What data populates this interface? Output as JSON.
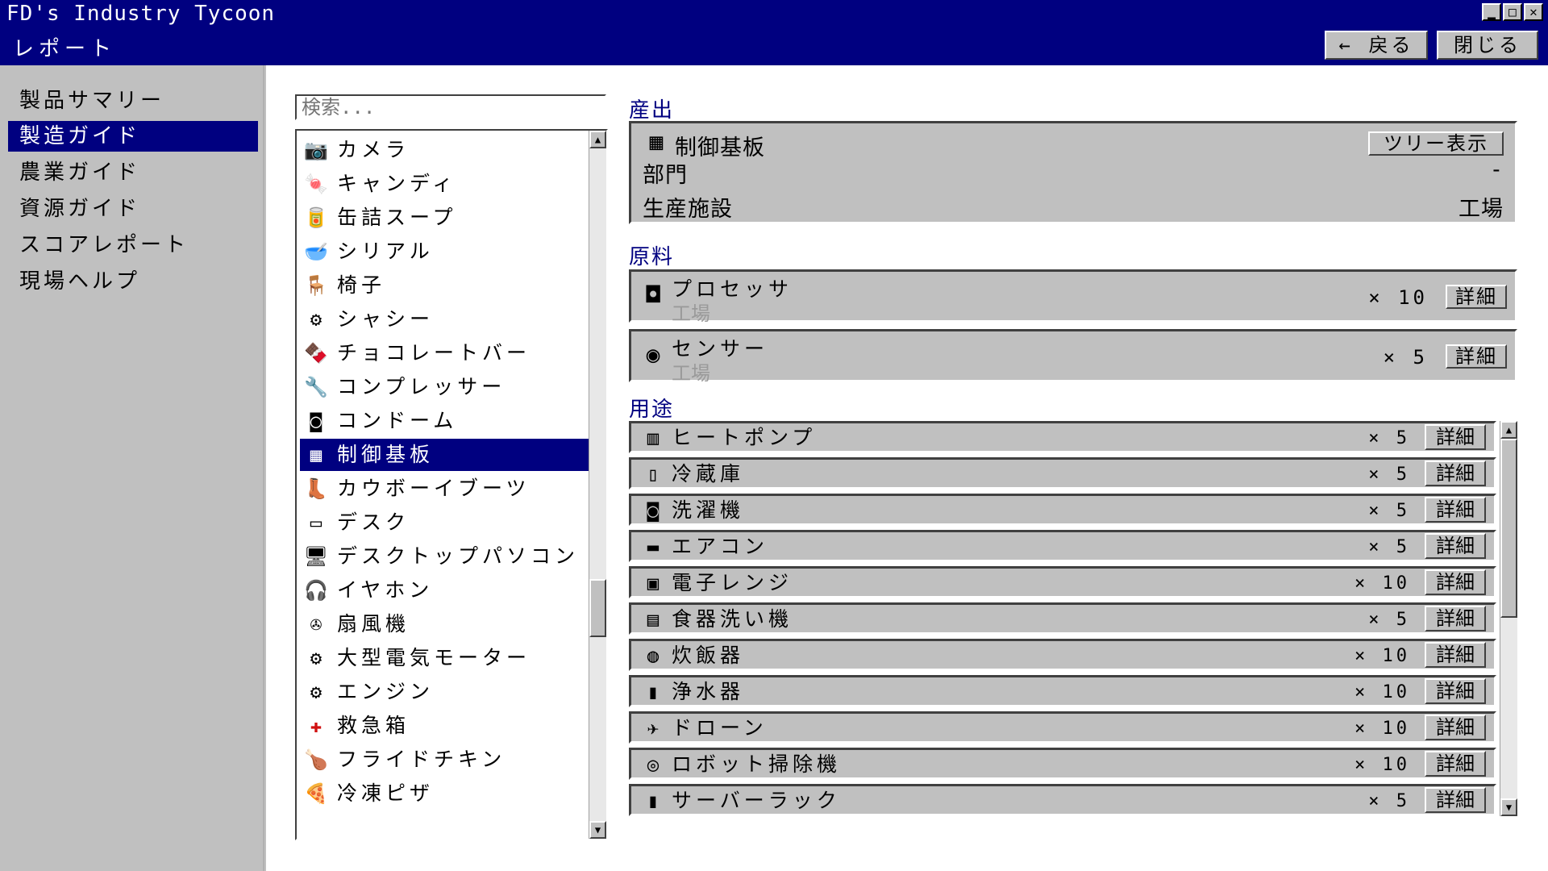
{
  "window": {
    "app_title": "FD's Industry Tycoon",
    "report_title": "レポート",
    "back_label": "← 戻る",
    "close_label": "閉じる"
  },
  "menu": {
    "items": [
      {
        "label": "製品サマリー"
      },
      {
        "label": "製造ガイド"
      },
      {
        "label": "農業ガイド"
      },
      {
        "label": "資源ガイド"
      },
      {
        "label": "スコアレポート"
      },
      {
        "label": "現場ヘルプ"
      }
    ],
    "active_index": 1
  },
  "search": {
    "placeholder": "検索...",
    "value": ""
  },
  "products": [
    {
      "name": "カメラ",
      "icon": "📷"
    },
    {
      "name": "キャンディ",
      "icon": "🍬"
    },
    {
      "name": "缶詰スープ",
      "icon": "🥫"
    },
    {
      "name": "シリアル",
      "icon": "🥣"
    },
    {
      "name": "椅子",
      "icon": "🪑"
    },
    {
      "name": "シャシー",
      "icon": "⚙"
    },
    {
      "name": "チョコレートバー",
      "icon": "🍫"
    },
    {
      "name": "コンプレッサー",
      "icon": "🔧"
    },
    {
      "name": "コンドーム",
      "icon": "◙"
    },
    {
      "name": "制御基板",
      "icon": "▦"
    },
    {
      "name": "カウボーイブーツ",
      "icon": "👢"
    },
    {
      "name": "デスク",
      "icon": "▭"
    },
    {
      "name": "デスクトップパソコン",
      "icon": "🖥"
    },
    {
      "name": "イヤホン",
      "icon": "🎧"
    },
    {
      "name": "扇風機",
      "icon": "✇"
    },
    {
      "name": "大型電気モーター",
      "icon": "⚙"
    },
    {
      "name": "エンジン",
      "icon": "⚙"
    },
    {
      "name": "救急箱",
      "icon": "✚"
    },
    {
      "name": "フライドチキン",
      "icon": "🍗"
    },
    {
      "name": "冷凍ピザ",
      "icon": "🍕"
    }
  ],
  "selected_product_index": 9,
  "output": {
    "heading": "産出",
    "product_name": "制御基板",
    "product_icon": "▦",
    "tree_button_label": "ツリー表示",
    "department_label": "部門",
    "department_value": "-",
    "facility_label": "生産施設",
    "facility_value": "工場"
  },
  "materials": {
    "heading": "原料",
    "items": [
      {
        "name": "プロセッサ",
        "source": "工場",
        "qty": "× 10",
        "icon": "◘"
      },
      {
        "name": "センサー",
        "source": "工場",
        "qty": "× 5",
        "icon": "◉"
      }
    ],
    "detail_label": "詳細"
  },
  "uses": {
    "heading": "用途",
    "detail_label": "詳細",
    "items": [
      {
        "name": "ヒートポンプ",
        "qty": "× 5",
        "icon": "▥"
      },
      {
        "name": "冷蔵庫",
        "qty": "× 5",
        "icon": "▯"
      },
      {
        "name": "洗濯機",
        "qty": "× 5",
        "icon": "◙"
      },
      {
        "name": "エアコン",
        "qty": "× 5",
        "icon": "▬"
      },
      {
        "name": "電子レンジ",
        "qty": "× 10",
        "icon": "▣"
      },
      {
        "name": "食器洗い機",
        "qty": "× 5",
        "icon": "▤"
      },
      {
        "name": "炊飯器",
        "qty": "× 10",
        "icon": "◍"
      },
      {
        "name": "浄水器",
        "qty": "× 10",
        "icon": "▮"
      },
      {
        "name": "ドローン",
        "qty": "× 10",
        "icon": "✈"
      },
      {
        "name": "ロボット掃除機",
        "qty": "× 10",
        "icon": "◎"
      },
      {
        "name": "サーバーラック",
        "qty": "× 5",
        "icon": "▮"
      }
    ]
  },
  "colors": {
    "title_bar": "#000080",
    "window_bg": "#c0c0c0",
    "selection": "#000080",
    "section_heading": "#000080"
  }
}
